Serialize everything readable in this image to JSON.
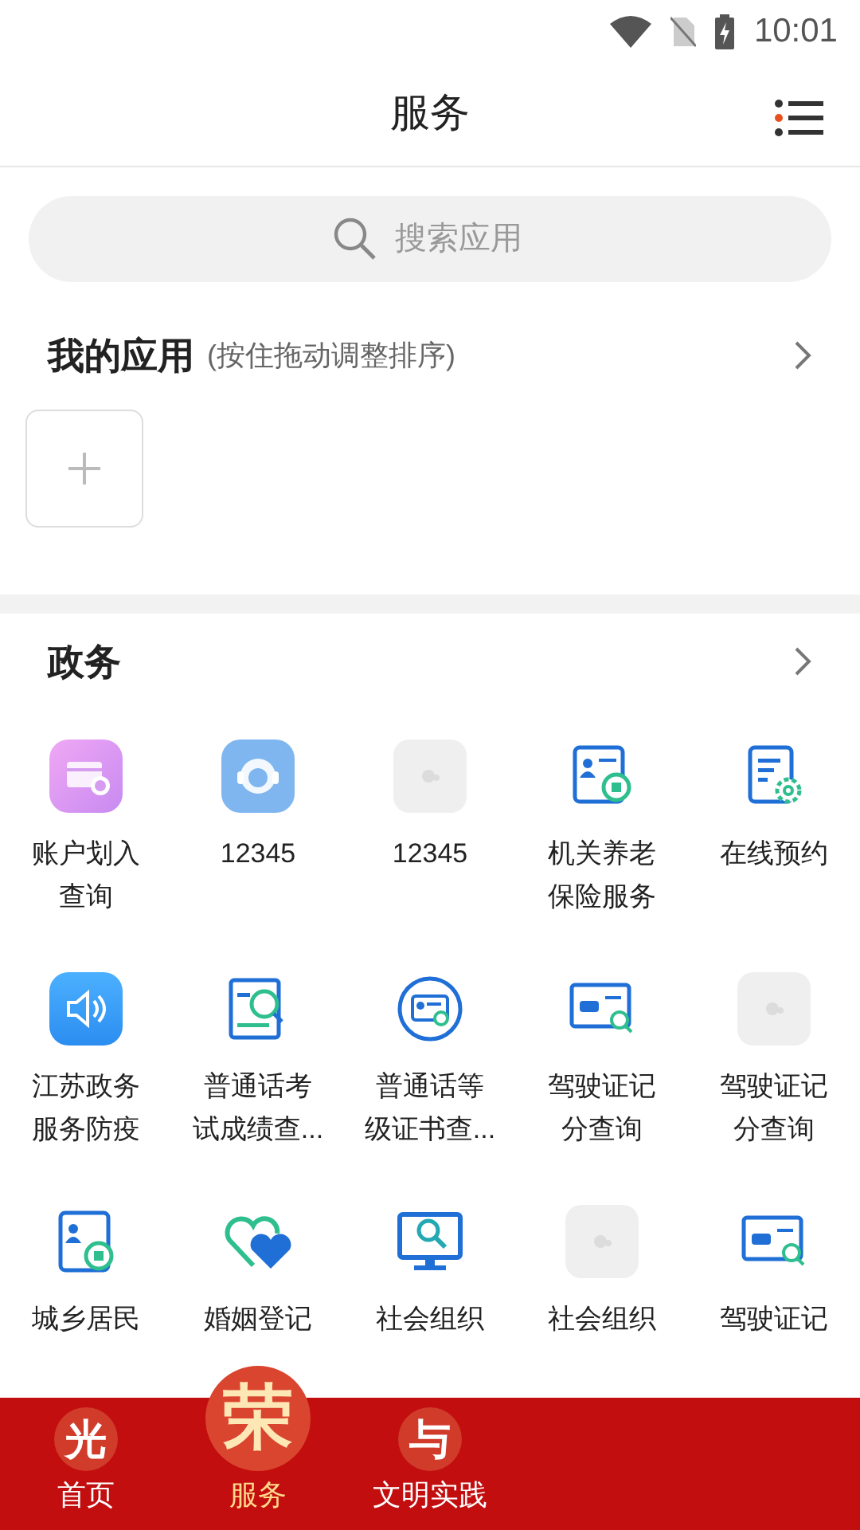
{
  "status_bar": {
    "time": "10:01"
  },
  "header": {
    "title": "服务"
  },
  "search": {
    "placeholder": "搜索应用"
  },
  "my_apps": {
    "title": "我的应用",
    "hint": "(按住拖动调整排序)"
  },
  "gov": {
    "title": "政务",
    "apps": [
      {
        "kind": "purple-card",
        "lines": [
          "账户划入",
          "查询"
        ]
      },
      {
        "kind": "headset",
        "lines": [
          "12345"
        ]
      },
      {
        "kind": "placeholder",
        "lines": [
          "12345"
        ]
      },
      {
        "kind": "pension",
        "lines": [
          "机关养老",
          "保险服务"
        ]
      },
      {
        "kind": "doc-gear",
        "lines": [
          "在线预约"
        ]
      },
      {
        "kind": "speaker",
        "lines": [
          "江苏政务",
          "服务防疫"
        ]
      },
      {
        "kind": "exam",
        "lines": [
          "普通话考",
          "试成绩查..."
        ]
      },
      {
        "kind": "badge",
        "lines": [
          "普通话等",
          "级证书查..."
        ]
      },
      {
        "kind": "car-search",
        "lines": [
          "驾驶证记",
          "分查询"
        ]
      },
      {
        "kind": "placeholder",
        "lines": [
          "驾驶证记",
          "分查询"
        ]
      },
      {
        "kind": "resident",
        "lines": [
          "城乡居民"
        ]
      },
      {
        "kind": "hearts",
        "lines": [
          "婚姻登记"
        ]
      },
      {
        "kind": "monitor",
        "lines": [
          "社会组织"
        ]
      },
      {
        "kind": "placeholder",
        "lines": [
          "社会组织"
        ]
      },
      {
        "kind": "car-search",
        "lines": [
          "驾驶证记"
        ]
      }
    ]
  },
  "tab_bar": [
    {
      "glyph": "光",
      "label": "首页",
      "selected": false
    },
    {
      "glyph": "荣",
      "label": "服务",
      "selected": true
    },
    {
      "glyph": "与",
      "label": "文明实践",
      "selected": false
    }
  ]
}
